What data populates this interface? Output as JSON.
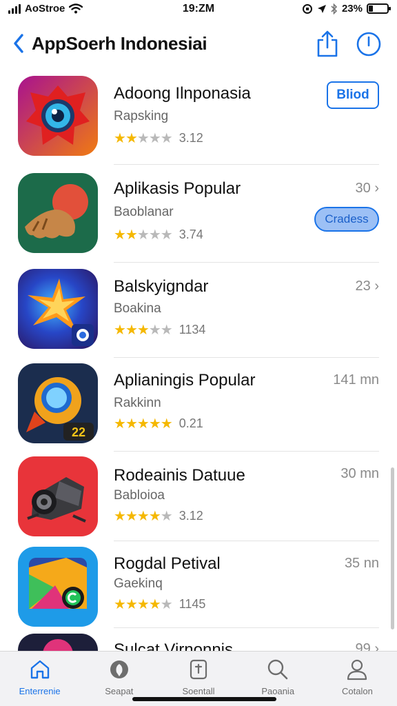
{
  "status_bar": {
    "carrier": "AoStroe",
    "time": "19:ZM",
    "battery": "23%",
    "battery_level": 0.23
  },
  "nav": {
    "title": "AppSoerh Indonesiai",
    "icons": [
      "chevron-left-icon",
      "share-icon",
      "info-icon"
    ]
  },
  "apps": [
    {
      "name": "Adoong Ilnponasia",
      "subtitle": "Rapsking",
      "rating": "3.12",
      "stars": 1.5,
      "action": "Bliod"
    },
    {
      "name": "Aplikasis Popular",
      "subtitle": "Baoblanar",
      "rating": "3.74",
      "stars": 2,
      "size": "30",
      "action": "Cradess"
    },
    {
      "name": "Balskyigndar",
      "subtitle": "Boakina",
      "rating": "1134",
      "stars": 3,
      "size": "23"
    },
    {
      "name": "Aplianingis Popular",
      "subtitle": "Rakkinn",
      "rating": "0.21",
      "stars": 4.5,
      "size": "141 mn"
    },
    {
      "name": "Rodeainis Datuue",
      "subtitle": "Babloioa",
      "rating": "3.12",
      "stars": 4,
      "size": "30 mn"
    },
    {
      "name": "Rogdal Petival",
      "subtitle": "Gaekinq",
      "rating": "1145",
      "stars": 4,
      "size": "35 nn"
    },
    {
      "name": "Sulcat Virnonnis",
      "subtitle": "",
      "rating": "",
      "stars": 0,
      "size": "99"
    }
  ],
  "tabs": [
    {
      "label": "Enterrenie",
      "icon": "home-icon",
      "active": true
    },
    {
      "label": "Seapat",
      "icon": "apps-icon",
      "active": false
    },
    {
      "label": "Soentall",
      "icon": "games-icon",
      "active": false
    },
    {
      "label": "Paoania",
      "icon": "search-icon",
      "active": false
    },
    {
      "label": "Cotalon",
      "icon": "person-icon",
      "active": false
    }
  ],
  "colors": {
    "accent": "#1a73e8",
    "star": "#f5b800"
  }
}
